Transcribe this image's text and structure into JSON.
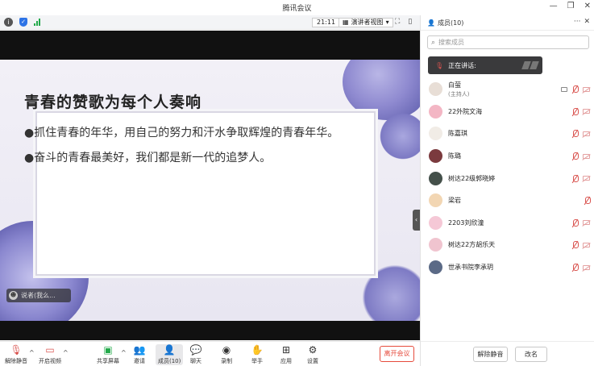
{
  "window": {
    "title": "腾讯会议",
    "min": "—",
    "restore": "❐",
    "close": "✕"
  },
  "meeting_bar": {
    "time": "21:11",
    "view_label": "演讲者视图",
    "view_caret": "▾"
  },
  "slide": {
    "title": "青春的赞歌为每个人奏响",
    "lines": [
      "●抓住青春的年华，用自己的努力和汗水争取辉煌的青春年华。",
      "●奋斗的青春最美好，我们都是新一代的追梦人。"
    ]
  },
  "presenter_tag": {
    "name": "说者(我么..."
  },
  "toolbar": {
    "mute": "解除静音",
    "video": "开启视频",
    "share": "共享屏幕",
    "invite": "邀请",
    "members": "成员(10)",
    "chat": "聊天",
    "record": "录制",
    "raise_hand": "举手",
    "apps": "应用",
    "settings": "设置",
    "leave": "离开会议"
  },
  "panel": {
    "title": "成员(10)",
    "search_placeholder": "搜索成员",
    "speaking_label": "正在讲话:",
    "members": [
      {
        "name": "白萤",
        "role": "(主持人)",
        "color": "#e8ded6",
        "screen": true
      },
      {
        "name": "22外院文海",
        "role": "",
        "color": "#f3b6c4",
        "screen": false
      },
      {
        "name": "陈嘉琪",
        "role": "",
        "color": "#f1ece6",
        "screen": false
      },
      {
        "name": "陈璐",
        "role": "",
        "color": "#7b3a3e",
        "screen": false
      },
      {
        "name": "树达22级郭晓婷",
        "role": "",
        "color": "#44504a",
        "screen": false
      },
      {
        "name": "梁岩",
        "role": "",
        "color": "#f2d6b3",
        "screen": false
      },
      {
        "name": "2203刘欣潼",
        "role": "",
        "color": "#f5c8d6",
        "screen": false
      },
      {
        "name": "树达22方胡乐天",
        "role": "",
        "color": "#f0c4cf",
        "screen": false
      },
      {
        "name": "世承书院李承玥",
        "role": "",
        "color": "#5b6a86",
        "screen": false
      }
    ],
    "unmute_all": "解除静音",
    "rename": "改名"
  }
}
